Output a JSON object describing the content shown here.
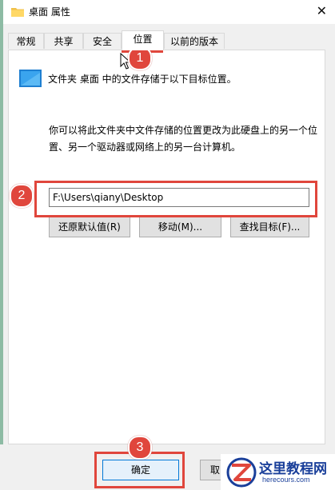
{
  "window": {
    "title": "桌面 属性",
    "close_glyph": "✕"
  },
  "tabs": [
    {
      "label": "常规"
    },
    {
      "label": "共享"
    },
    {
      "label": "安全"
    },
    {
      "label": "位置",
      "active": true
    },
    {
      "label": "以前的版本"
    }
  ],
  "location": {
    "description": "文件夹 桌面 中的文件存储于以下目标位置。",
    "info": "你可以将此文件夹中文件存储的位置更改为此硬盘上的另一个位置、另一个驱动器或网络上的另一台计算机。",
    "path_value": "F:\\Users\\qiany\\Desktop",
    "restore_default_label": "还原默认值(R)",
    "move_label": "移动(M)...",
    "find_target_label": "查找目标(F)..."
  },
  "footer": {
    "ok_label": "确定",
    "cancel_label": "取"
  },
  "annotations": {
    "marker_1": "1",
    "marker_2": "2",
    "marker_3": "3",
    "color": "#e0463c"
  },
  "watermark": {
    "title": "这里教程网",
    "url": "herecours.com"
  },
  "icons": {
    "window": "folder-icon",
    "description": "desktop-folder-icon",
    "pointer": "mouse-cursor-icon"
  },
  "colors": {
    "accent": "#0078d7",
    "annotation": "#e0463c",
    "watermark": "#1a3f9a"
  }
}
